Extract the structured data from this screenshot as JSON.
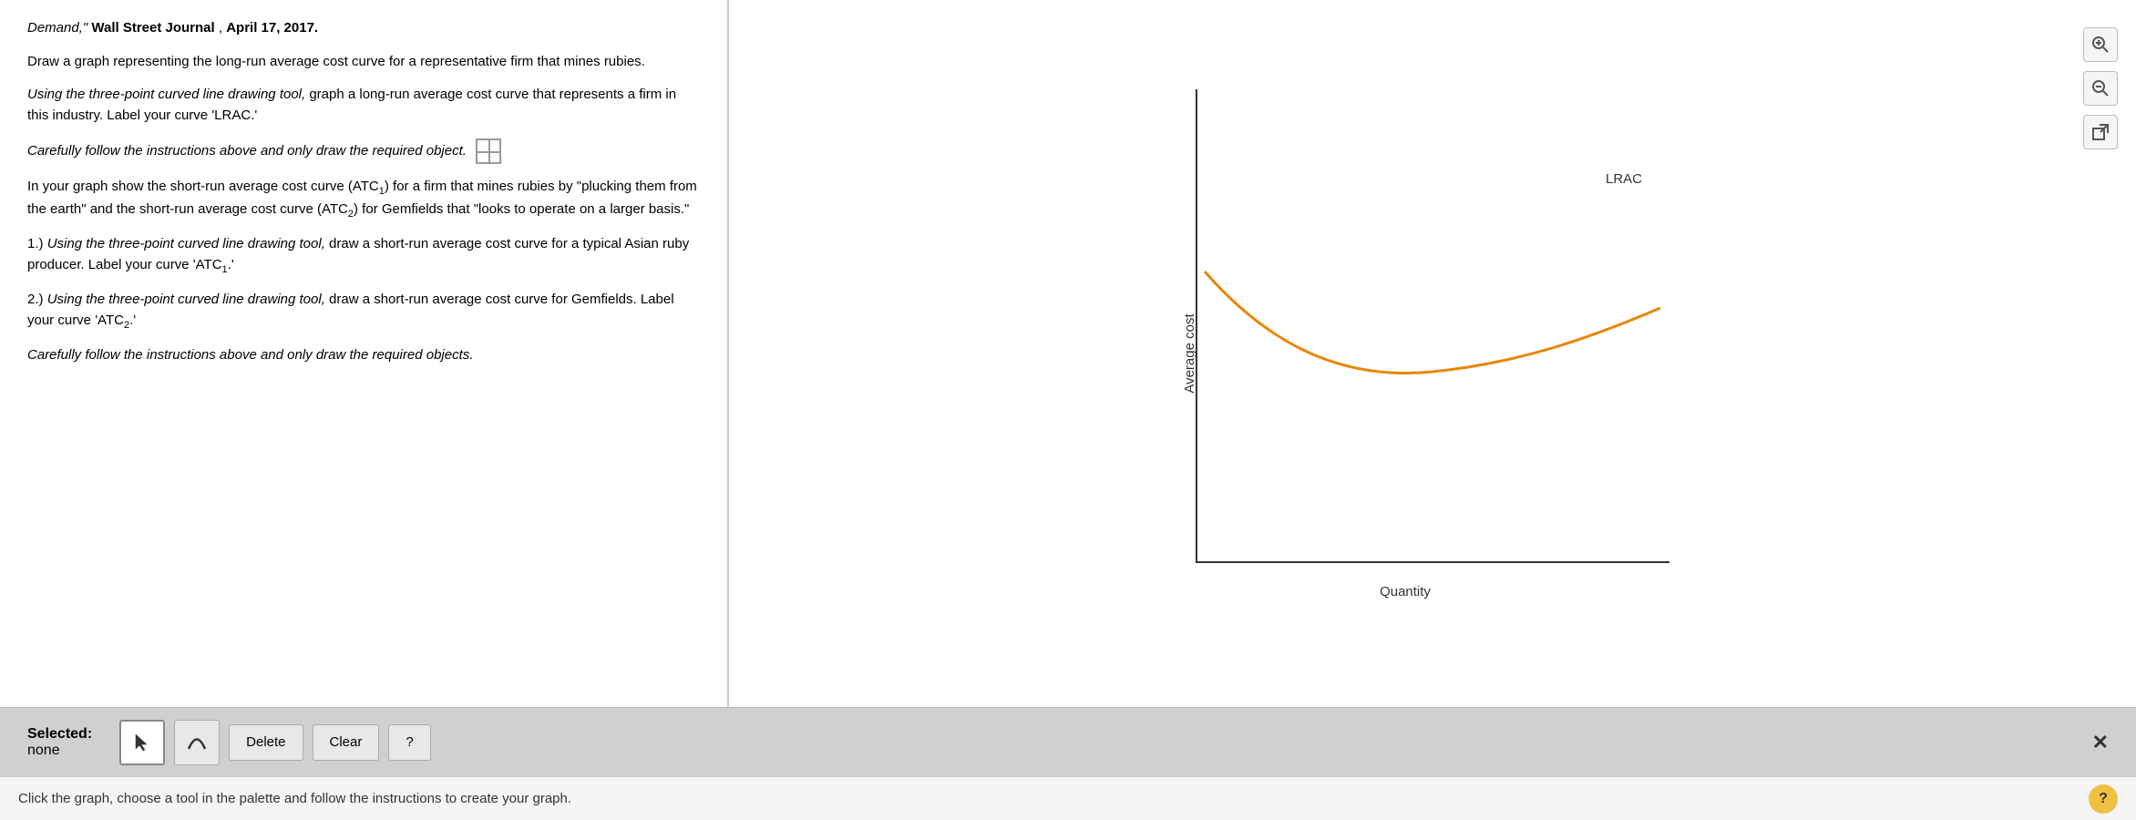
{
  "left": {
    "paragraph1": {
      "italic_prefix": "Demand,\"",
      "bold_content": " Wall Street Journal",
      "suffix": ", April 17, 2017."
    },
    "paragraph2": "Draw a graph representing the long-run average cost curve for a representative firm that mines rubies.",
    "paragraph3_italic": "Using the three-point curved line drawing tool,",
    "paragraph3_rest": " graph a long-run average cost curve that represents a firm in this industry. Label your curve 'LRAC.'",
    "paragraph4_italic": "Carefully follow the instructions above and only draw the required object.",
    "paragraph5_start": "In your graph show the short-run average cost curve (ATC",
    "paragraph5_sub1": "1",
    "paragraph5_mid": ") for a firm that mines rubies by \"plucking them from the earth\" and the short-run average cost curve (ATC",
    "paragraph5_sub2": "2",
    "paragraph5_end": ") for Gemfields that \"looks to operate on a larger basis.\"",
    "paragraph6_italic": "Using the three-point curved line drawing tool,",
    "paragraph6_rest": " draw a short-run average cost curve for a typical Asian ruby producer. Label your curve 'ATC",
    "paragraph6_sub": "1",
    "paragraph6_end": ".'",
    "paragraph7_italic": "Using the three-point curved line drawing tool,",
    "paragraph7_rest": " draw a short-run average cost curve for Gemfields. Label your curve 'ATC",
    "paragraph7_sub": "2",
    "paragraph7_end": ".'",
    "paragraph8_italic": "Carefully follow the instructions above and only draw the required objects."
  },
  "graph": {
    "x_axis_label": "Quantity",
    "y_axis_label": "Average cost",
    "curve_label": "LRAC"
  },
  "toolbar": {
    "selected_label": "Selected:",
    "selected_value": "none",
    "delete_label": "Delete",
    "clear_label": "Clear",
    "help_label": "?",
    "zoom_in_icon": "zoom-in",
    "zoom_out_icon": "zoom-out",
    "external_icon": "external-link"
  },
  "status_bar": {
    "instruction": "Click the graph, choose a tool in the palette and follow the instructions to create your graph.",
    "help_label": "?"
  }
}
